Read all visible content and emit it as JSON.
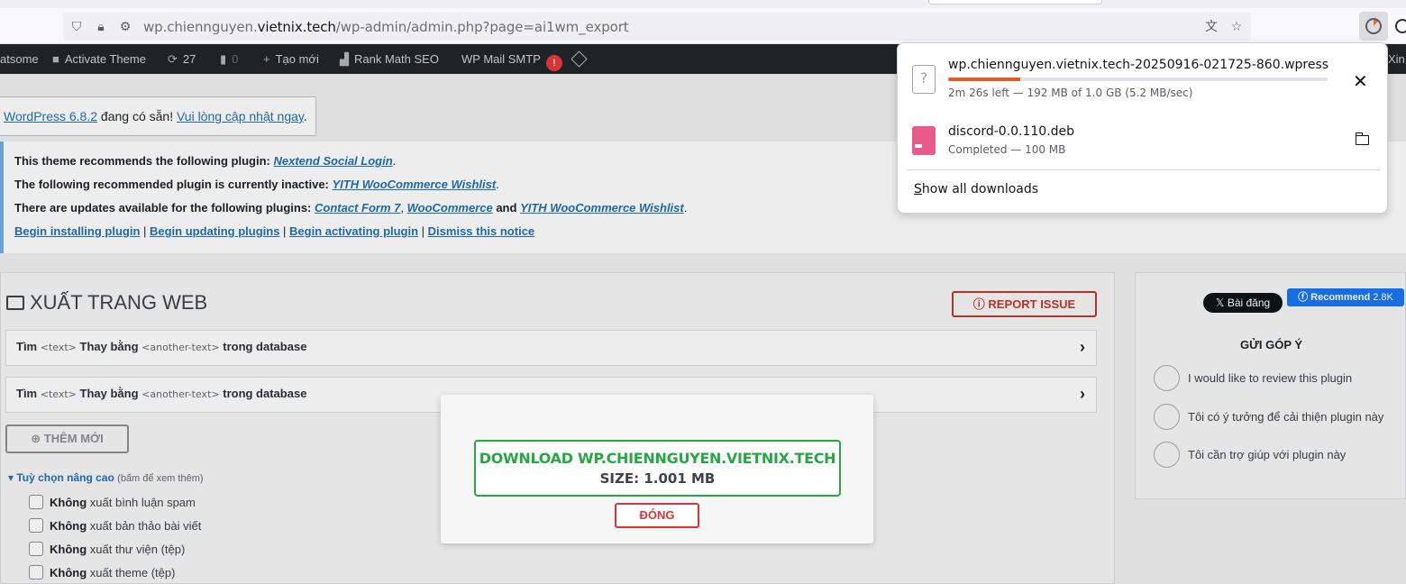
{
  "browser": {
    "url_prefix": "wp.chiennguyen.",
    "url_domain": "vietnix.tech",
    "url_path": "/wp-admin/admin.php?page=ai1wm_export"
  },
  "adminbar": {
    "site_name": "atsome",
    "activate_theme": "Activate Theme",
    "updates_count": "27",
    "comments_count": "0",
    "new_label": "Tạo mới",
    "rankmath": "Rank Math SEO",
    "wpmail": "WP Mail SMTP",
    "wpmail_badge": "!",
    "right_text": "Xin"
  },
  "update_nag": {
    "link": "WordPress 6.8.2",
    "text": " đang có sẵn! ",
    "cta": "Vui lòng cập nhật ngay",
    "tail": "."
  },
  "notice": {
    "line1_text": "This theme recommends the following plugin: ",
    "line1_plugin": "Nextend Social Login",
    "line2_text": "The following recommended plugin is currently inactive: ",
    "line2_plugin": "YITH WooCommerce Wishlist",
    "line3_text": "There are updates available for the following plugins: ",
    "line3_p1": "Contact Form 7",
    "line3_p2": "WooCommerce",
    "line3_and": " and ",
    "line3_p3": "YITH WooCommerce Wishlist",
    "actions": [
      "Begin installing plugin",
      "Begin updating plugins",
      "Begin activating plugin",
      "Dismiss this notice"
    ],
    "sep": " | ",
    "dot": ",",
    "period": "."
  },
  "export": {
    "title": "XUẤT TRANG WEB",
    "report_issue": "REPORT ISSUE",
    "find_label": "Tìm",
    "text_placeholder": "<text>",
    "replace_label": "Thay bằng",
    "another_placeholder": "<another-text>",
    "in_db": "trong database",
    "add_new": "THÊM MỚI",
    "advanced": "Tuỳ chọn nâng cao",
    "advanced_hint": "(bấm để xem thêm)",
    "not_label": "Không",
    "options": [
      "xuất bình luận spam",
      "xuất bản thảo bài viết",
      "xuất thư viện (tệp)",
      "xuất theme (tệp)"
    ]
  },
  "sidebar": {
    "x_post": "Bài đăng",
    "fb_recommend": "Recommend",
    "fb_count": "2.8K",
    "feedback_title": "GỬI GÓP Ý",
    "feedback_options": [
      "I would like to review this plugin",
      "Tôi có ý tưởng để cải thiện plugin này",
      "Tôi cần trợ giúp với plugin này"
    ]
  },
  "modal": {
    "download_label": "DOWNLOAD WP.CHIENNGUYEN.VIETNIX.TECH",
    "size_label": "SIZE: 1.001 MB",
    "close_label": "ĐÓNG"
  },
  "downloads": {
    "items": [
      {
        "name": "wp.chiennguyen.vietnix.tech-20250916-021725-860.wpress",
        "status": "2m 26s left — 192 MB of 1.0 GB (5.2 MB/sec)",
        "progress": 0.19,
        "icon": "unknown-file-icon"
      },
      {
        "name": "discord-0.0.110.deb",
        "status": "Completed — 100 MB",
        "icon": "deb-package-icon"
      }
    ],
    "show_all_prefix": "S",
    "show_all_rest": "how all downloads"
  },
  "colors": {
    "admin_bar": "#1d2327",
    "wp_link": "#2271b1",
    "success_green": "#27a744",
    "danger_red": "#d63638",
    "download_progress": "#e65a25"
  }
}
